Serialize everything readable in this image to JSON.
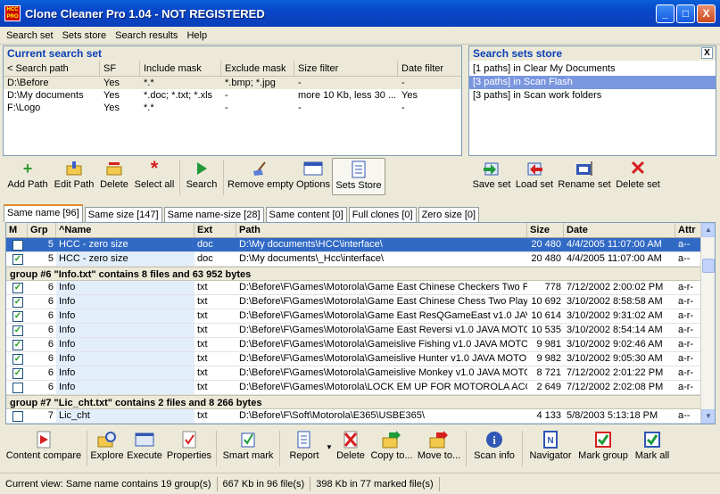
{
  "window": {
    "title": "Clone Cleaner Pro 1.04 - NOT REGISTERED",
    "minimize": "_",
    "maximize": "□",
    "close": "X"
  },
  "menu": [
    "Search set",
    "Sets store",
    "Search results",
    "Help"
  ],
  "search_set": {
    "title": "Current search set",
    "columns": [
      "< Search path",
      "SF",
      "Include mask",
      "Exclude mask",
      "Size filter",
      "Date filter"
    ],
    "rows": [
      [
        "D:\\Before",
        "Yes",
        "*.*",
        "*.bmp; *.jpg",
        "-",
        "-"
      ],
      [
        "D:\\My documents",
        "Yes",
        "*.doc; *.txt; *.xls",
        "-",
        "more 10 Kb, less 30 ...",
        "Yes"
      ],
      [
        "F:\\Logo",
        "Yes",
        "*.*",
        "-",
        "-",
        "-"
      ]
    ]
  },
  "toolbar": {
    "add_path": "Add Path",
    "edit_path": "Edit Path",
    "delete": "Delete",
    "select_all": "Select all",
    "search": "Search",
    "remove_empty": "Remove empty",
    "options": "Options",
    "sets_store": "Sets Store"
  },
  "store": {
    "title": "Search sets store",
    "close": "X",
    "items": [
      "[1 paths] in Clear My Documents",
      "[3 paths] in Scan Flash",
      "[3 paths] in Scan work folders"
    ],
    "save_set": "Save set",
    "load_set": "Load set",
    "rename_set": "Rename set",
    "delete_set": "Delete set"
  },
  "tabs": [
    "Same name [96]",
    "Same size [147]",
    "Same name-size [28]",
    "Same content [0]",
    "Full clones [0]",
    "Zero size [0]"
  ],
  "results": {
    "columns": [
      "M",
      "Grp",
      "^Name",
      "Ext",
      "Path",
      "Size",
      "Date",
      "Attr"
    ],
    "rows": [
      {
        "kind": "row",
        "checked": false,
        "sel": true,
        "grp": "5",
        "name": "HCC - zero size",
        "ext": "doc",
        "path": "D:\\My documents\\HCC\\interface\\",
        "size": "20 480",
        "date": "4/4/2005 11:07:00 AM",
        "attr": "a--"
      },
      {
        "kind": "row",
        "checked": true,
        "grp": "5",
        "name": "HCC - zero size",
        "ext": "doc",
        "path": "D:\\My documents\\_Hcc\\interface\\",
        "size": "20 480",
        "date": "4/4/2005 11:07:00 AM",
        "attr": "a--"
      },
      {
        "kind": "group",
        "text": "group #6 \"Info.txt\" contains 8 files and 63 952 bytes"
      },
      {
        "kind": "row",
        "checked": true,
        "grp": "6",
        "name": "Info",
        "ext": "txt",
        "path": "D:\\Before\\F\\Games\\Motorola\\Game East Chinese Checkers Two P",
        "size": "778",
        "date": "7/12/2002 2:00:02 PM",
        "attr": "a-r-"
      },
      {
        "kind": "row",
        "checked": true,
        "grp": "6",
        "name": "Info",
        "ext": "txt",
        "path": "D:\\Before\\F\\Games\\Motorola\\Game East Chinese Chess Two Playe",
        "size": "10 692",
        "date": "3/10/2002 8:58:58 AM",
        "attr": "a-r-"
      },
      {
        "kind": "row",
        "checked": true,
        "grp": "6",
        "name": "Info",
        "ext": "txt",
        "path": "D:\\Before\\F\\Games\\Motorola\\Game East ResQGameEast v1.0 JAV",
        "size": "10 614",
        "date": "3/10/2002 9:31:02 AM",
        "attr": "a-r-"
      },
      {
        "kind": "row",
        "checked": true,
        "grp": "6",
        "name": "Info",
        "ext": "txt",
        "path": "D:\\Before\\F\\Games\\Motorola\\Game East Reversi v1.0 JAVA MOTO",
        "size": "10 535",
        "date": "3/10/2002 8:54:14 AM",
        "attr": "a-r-"
      },
      {
        "kind": "row",
        "checked": true,
        "grp": "6",
        "name": "Info",
        "ext": "txt",
        "path": "D:\\Before\\F\\Games\\Motorola\\Gameislive Fishing v1.0 JAVA MOTO",
        "size": "9 981",
        "date": "3/10/2002 9:02:46 AM",
        "attr": "a-r-"
      },
      {
        "kind": "row",
        "checked": true,
        "grp": "6",
        "name": "Info",
        "ext": "txt",
        "path": "D:\\Before\\F\\Games\\Motorola\\Gameislive Hunter v1.0 JAVA MOTO",
        "size": "9 982",
        "date": "3/10/2002 9:05:30 AM",
        "attr": "a-r-"
      },
      {
        "kind": "row",
        "checked": true,
        "grp": "6",
        "name": "Info",
        "ext": "txt",
        "path": "D:\\Before\\F\\Games\\Motorola\\Gameislive Monkey v1.0 JAVA MOTO(",
        "size": "8 721",
        "date": "7/12/2002 2:01:22 PM",
        "attr": "a-r-"
      },
      {
        "kind": "row",
        "checked": false,
        "grp": "6",
        "name": "Info",
        "ext": "txt",
        "path": "D:\\Before\\F\\Games\\Motorola\\LOCK EM UP FOR MOTOROLA ACC",
        "size": "2 649",
        "date": "7/12/2002 2:02:08 PM",
        "attr": "a-r-"
      },
      {
        "kind": "group",
        "text": "group #7 \"Lic_cht.txt\" contains 2 files and 8 266 bytes"
      },
      {
        "kind": "row",
        "checked": false,
        "grp": "7",
        "name": "Lic_cht",
        "ext": "txt",
        "path": "D:\\Before\\F\\Soft\\Motorola\\E365\\USBE365\\",
        "size": "4 133",
        "date": "5/8/2003 5:13:18 PM",
        "attr": "a--"
      }
    ]
  },
  "bottom_toolbar": {
    "content_compare": "Content compare",
    "explore": "Explore",
    "execute": "Execute",
    "properties": "Properties",
    "smart_mark": "Smart mark",
    "report": "Report",
    "delete": "Delete",
    "copy_to": "Copy to...",
    "move_to": "Move to...",
    "scan_info": "Scan info",
    "navigator": "Navigator",
    "mark_group": "Mark group",
    "mark_all": "Mark all"
  },
  "status": [
    "Current view: Same name contains 19 group(s)",
    "667 Kb in 96 file(s)",
    "398 Kb in 77 marked file(s)"
  ]
}
